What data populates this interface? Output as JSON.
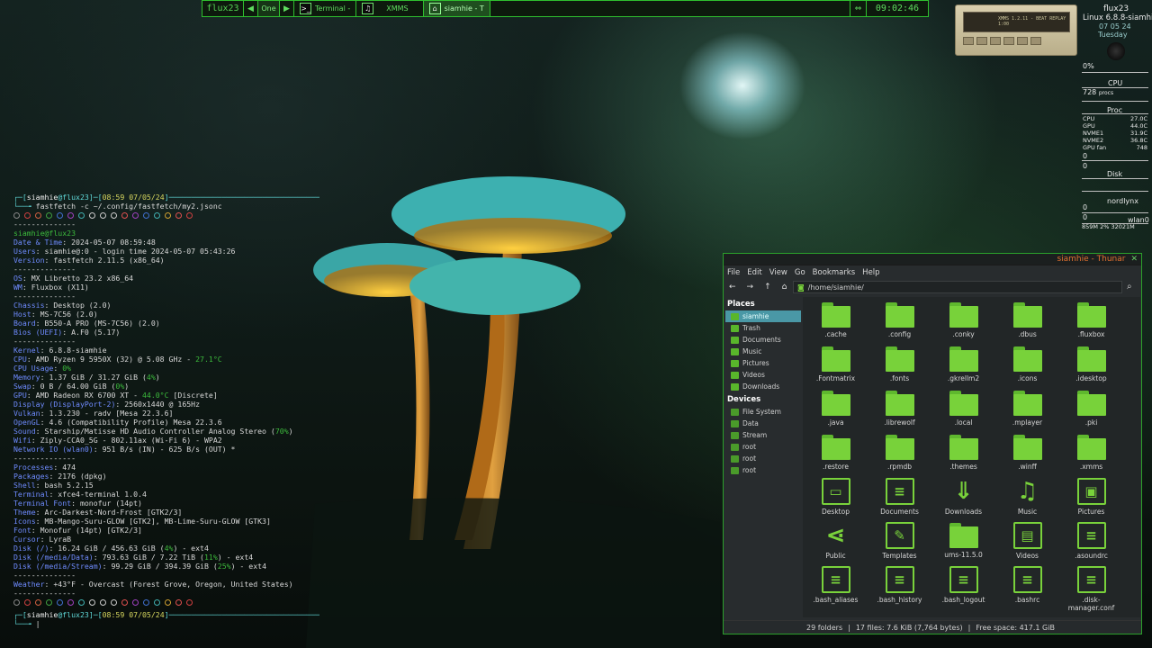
{
  "colors": {
    "accent": "#2fbf2f",
    "prompt": "#5fd7d7",
    "key": "#6f8bff",
    "thunar_selection": "#4a98a6",
    "folder": "#78d23a"
  },
  "taskbar": {
    "workspace_name": "flux23",
    "prev_icon": "triangle-left-icon",
    "next_icon": "triangle-right-icon",
    "current_workspace": "One",
    "tasks": [
      {
        "icon": "terminal-icon",
        "label": "Terminal -"
      },
      {
        "icon": "audio-player-icon",
        "label": "XMMS"
      },
      {
        "icon": "home-folder-icon",
        "label": "siamhie - T"
      }
    ],
    "clock": "09:02:46"
  },
  "xmms": {
    "display_text": "XMMS 1.2.11 - BEAT REPLAY 1:00"
  },
  "conky": {
    "host": "flux23",
    "kernel": "Linux 6.8.8-siamhie",
    "date": "07 05 24",
    "day": "Tuesday",
    "cpu_pct": "0%",
    "cpu_label": "CPU",
    "procs": "728",
    "procs_unit": "procs",
    "proc_label": "Proc",
    "temps": [
      {
        "name": "CPU",
        "val": "27.0C"
      },
      {
        "name": "GPU",
        "val": "44.0C"
      },
      {
        "name": "NVME1",
        "val": "31.9C"
      },
      {
        "name": "NVME2",
        "val": "36.8C"
      },
      {
        "name": "GPU fan",
        "val": "748"
      }
    ],
    "zero1": "0",
    "disk_label": "Disk",
    "zero2": "0",
    "vpn": "nordlynx",
    "zero3": "0",
    "zero4": "0",
    "wlan": "wlan0",
    "net_stats": "859M 2% 32021M"
  },
  "terminal": {
    "prompt_user": "siamhie",
    "prompt_host": "flux23",
    "prompt_time": "08:59",
    "prompt_date": "07/05/24",
    "prompt_end": "[-]",
    "command": "fastfetch -c ~/.config/fastfetch/my2.jsonc",
    "title": "siamhie@flux23",
    "separator": "--------------",
    "info": [
      {
        "k": "Date & Time",
        "v": "2024-05-07 08:59:48"
      },
      {
        "k": "Users",
        "v": "siamhie@:0 - login time 2024-05-07 05:43:26"
      },
      {
        "k": "Version",
        "v": "fastfetch 2.11.5 (x86_64)"
      },
      {
        "sep": true
      },
      {
        "k": "OS",
        "v": "MX Libretto 23.2 x86_64"
      },
      {
        "k": "WM",
        "v": "Fluxbox (X11)"
      },
      {
        "sep": true
      },
      {
        "k": "Chassis",
        "v": "Desktop (2.0)"
      },
      {
        "k": "Host",
        "v": "MS-7C56 (2.0)"
      },
      {
        "k": "Board",
        "v": "B550-A PRO (MS-7C56) (2.0)"
      },
      {
        "k": "Bios (UEFI)",
        "v": "A.F0 (5.17)"
      },
      {
        "sep": true
      },
      {
        "k": "Kernel",
        "v": "6.8.8-siamhie"
      },
      {
        "k": "CPU",
        "v": "AMD Ryzen 9 5950X (32) @ 5.08 GHz - ",
        "g": "27.1°C"
      },
      {
        "k": "CPU Usage",
        "v": "",
        "g": "0%"
      },
      {
        "k": "Memory",
        "v": "1.37 GiB / 31.27 GiB (",
        "g": "4%",
        "e": ")"
      },
      {
        "k": "Swap",
        "v": "0 B / 64.00 GiB (",
        "g": "0%",
        "e": ")"
      },
      {
        "k": "GPU",
        "v": "AMD Radeon RX 6700 XT - ",
        "g": "44.0°C",
        "e": " [Discrete]"
      },
      {
        "k": "Display (DisplayPort-2)",
        "v": "2560x1440 @ 165Hz"
      },
      {
        "k": "Vulkan",
        "v": "1.3.230 - radv [Mesa 22.3.6]"
      },
      {
        "k": "OpenGL",
        "v": "4.6 (Compatibility Profile) Mesa 22.3.6"
      },
      {
        "k": "Sound",
        "v": "Starship/Matisse HD Audio Controller Analog Stereo (",
        "g": "70%",
        "e": ")"
      },
      {
        "k": "Wifi",
        "v": "Ziply-CCA0_5G - 802.11ax (Wi-Fi 6) - WPA2"
      },
      {
        "k": "Network IO (wlan0)",
        "v": "951 B/s (IN) - 625 B/s (OUT) *"
      },
      {
        "sep": true
      },
      {
        "k": "Processes",
        "v": "474"
      },
      {
        "k": "Packages",
        "v": "2176 (dpkg)"
      },
      {
        "k": "Shell",
        "v": "bash 5.2.15"
      },
      {
        "k": "Terminal",
        "v": "xfce4-terminal 1.0.4"
      },
      {
        "k": "Terminal Font",
        "v": "monofur (14pt)"
      },
      {
        "k": "Theme",
        "v": "Arc-Darkest-Nord-Frost [GTK2/3]"
      },
      {
        "k": "Icons",
        "v": "MB-Mango-Suru-GLOW [GTK2], MB-Lime-Suru-GLOW [GTK3]"
      },
      {
        "k": "Font",
        "v": "Monofur (14pt) [GTK2/3]"
      },
      {
        "k": "Cursor",
        "v": "LyraB"
      },
      {
        "k": "Disk (/)",
        "v": "16.24 GiB / 456.63 GiB (",
        "g": "4%",
        "e": ") - ext4"
      },
      {
        "k": "Disk (/media/Data)",
        "v": "793.63 GiB / 7.22 TiB (",
        "g": "11%",
        "e": ") - ext4"
      },
      {
        "k": "Disk (/media/Stream)",
        "v": "99.29 GiB / 394.39 GiB (",
        "g": "25%",
        "e": ") - ext4"
      },
      {
        "sep": true
      },
      {
        "k": "Weather",
        "v": "+43°F - Overcast (Forest Grove, Oregon, United States)"
      },
      {
        "sep": true
      }
    ],
    "palette": [
      "#888888",
      "#d04040",
      "#d06040",
      "#40a040",
      "#4070d0",
      "#a040c0",
      "#40b0b0",
      "#cccccc"
    ],
    "palette2": [
      "#cccccc",
      "#cccccc",
      "#e05050",
      "#a040c0",
      "#4070d0",
      "#40b0b0",
      "#d0a030",
      "#e05050",
      "#d04040"
    ],
    "cursor": "|"
  },
  "thunar": {
    "title": "siamhie - Thunar",
    "close_icon": "close-icon",
    "menu": [
      "File",
      "Edit",
      "View",
      "Go",
      "Bookmarks",
      "Help"
    ],
    "path": "/home/siamhie/",
    "places_header": "Places",
    "places": [
      "siamhie",
      "Trash",
      "Documents",
      "Music",
      "Pictures",
      "Videos",
      "Downloads"
    ],
    "devices_header": "Devices",
    "devices": [
      "File System",
      "Data",
      "Stream",
      "root",
      "root",
      "root"
    ],
    "files": [
      {
        "name": ".cache",
        "kind": "folder"
      },
      {
        "name": ".config",
        "kind": "folder"
      },
      {
        "name": ".conky",
        "kind": "folder"
      },
      {
        "name": ".dbus",
        "kind": "folder"
      },
      {
        "name": ".fluxbox",
        "kind": "folder"
      },
      {
        "name": ".Fontmatrix",
        "kind": "folder"
      },
      {
        "name": ".fonts",
        "kind": "folder"
      },
      {
        "name": ".gkrellm2",
        "kind": "folder"
      },
      {
        "name": ".icons",
        "kind": "folder"
      },
      {
        "name": ".idesktop",
        "kind": "folder"
      },
      {
        "name": ".java",
        "kind": "folder"
      },
      {
        "name": ".librewolf",
        "kind": "folder"
      },
      {
        "name": ".local",
        "kind": "folder"
      },
      {
        "name": ".mplayer",
        "kind": "folder"
      },
      {
        "name": ".pki",
        "kind": "folder"
      },
      {
        "name": ".restore",
        "kind": "folder"
      },
      {
        "name": ".rpmdb",
        "kind": "folder"
      },
      {
        "name": ".themes",
        "kind": "folder"
      },
      {
        "name": ".winff",
        "kind": "folder"
      },
      {
        "name": ".xmms",
        "kind": "folder"
      },
      {
        "name": "Desktop",
        "kind": "desktop"
      },
      {
        "name": "Documents",
        "kind": "doc"
      },
      {
        "name": "Downloads",
        "kind": "download"
      },
      {
        "name": "Music",
        "kind": "music"
      },
      {
        "name": "Pictures",
        "kind": "picture"
      },
      {
        "name": "Public",
        "kind": "share"
      },
      {
        "name": "Templates",
        "kind": "template"
      },
      {
        "name": "ums-11.5.0",
        "kind": "folder"
      },
      {
        "name": "Videos",
        "kind": "video"
      },
      {
        "name": ".asoundrc",
        "kind": "doc"
      },
      {
        "name": ".bash_aliases",
        "kind": "doc"
      },
      {
        "name": ".bash_history",
        "kind": "doc"
      },
      {
        "name": ".bash_logout",
        "kind": "doc"
      },
      {
        "name": ".bashrc",
        "kind": "doc"
      },
      {
        "name": ".disk-manager.conf",
        "kind": "doc"
      }
    ],
    "status": {
      "folders": "29 folders",
      "files": "17 files: 7.6 KiB (7,764 bytes)",
      "free": "Free space: 417.1 GiB"
    }
  }
}
